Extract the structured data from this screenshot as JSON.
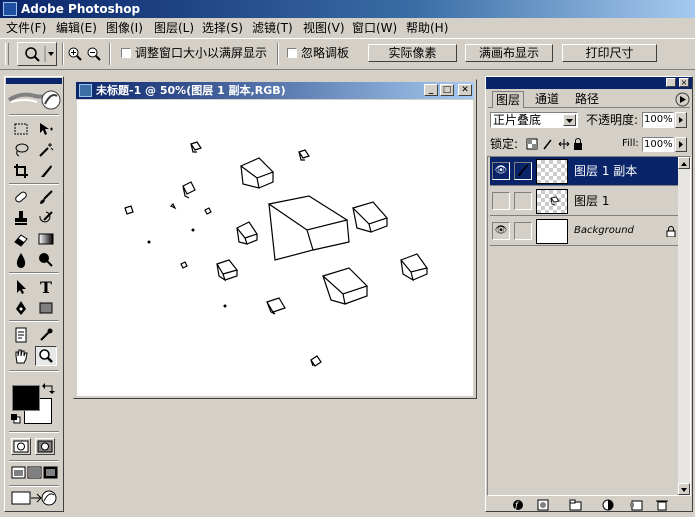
{
  "app": {
    "title": "Adobe Photoshop"
  },
  "menu": [
    "文件(F)",
    "编辑(E)",
    "图像(I)",
    "图层(L)",
    "选择(S)",
    "滤镜(T)",
    "视图(V)",
    "窗口(W)",
    "帮助(H)"
  ],
  "options": {
    "resize_windows_label": "调整窗口大小以满屏显示",
    "ignore_palettes_label": "忽略调板",
    "actual_pixels": "实际像素",
    "fit_on_screen": "满画布显示",
    "print_size": "打印尺寸"
  },
  "document": {
    "title": "未标题-1 @ 50%(图层 1 副本,RGB)"
  },
  "layers_panel": {
    "tabs": [
      "图层",
      "通道",
      "路径"
    ],
    "blend_mode": "正片叠底",
    "opacity_label": "不透明度:",
    "opacity_value": "100%",
    "lock_label": "锁定:",
    "fill_label": "Fill:",
    "fill_value": "100%",
    "layers": [
      {
        "name": "图层 1 副本",
        "selected": true,
        "visible": true
      },
      {
        "name": "图层 1",
        "selected": false,
        "visible": false
      },
      {
        "name": "Background",
        "selected": false,
        "visible": true,
        "locked": true
      }
    ]
  },
  "colors": {
    "accent": "#0a246a",
    "face": "#d4d0c8"
  }
}
